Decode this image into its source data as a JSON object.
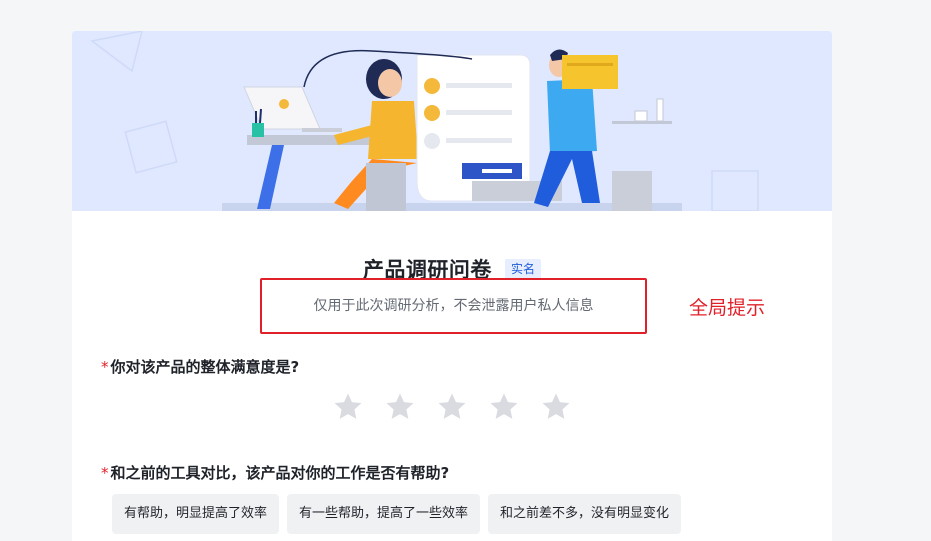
{
  "survey": {
    "title": "产品调研问卷",
    "tag": "实名",
    "hint": "仅用于此次调研分析，不会泄露用户私人信息"
  },
  "annotation": {
    "label": "全局提示",
    "color": "#e0212a"
  },
  "questions": [
    {
      "required_mark": "*",
      "text": "你对该产品的整体满意度是?",
      "type": "rating",
      "max_stars": 5,
      "selected": 0
    },
    {
      "required_mark": "*",
      "text": "和之前的工具对比，该产品对你的工作是否有帮助?",
      "type": "single-choice",
      "options": [
        "有帮助，明显提高了效率",
        "有一些帮助，提高了一些效率",
        "和之前差不多，没有明显变化"
      ]
    }
  ],
  "colors": {
    "accent": "#1f5ddc",
    "banner_bg": "#dfe8ff",
    "star_empty": "#d9dbe1",
    "option_bg": "#f0f1f3"
  }
}
